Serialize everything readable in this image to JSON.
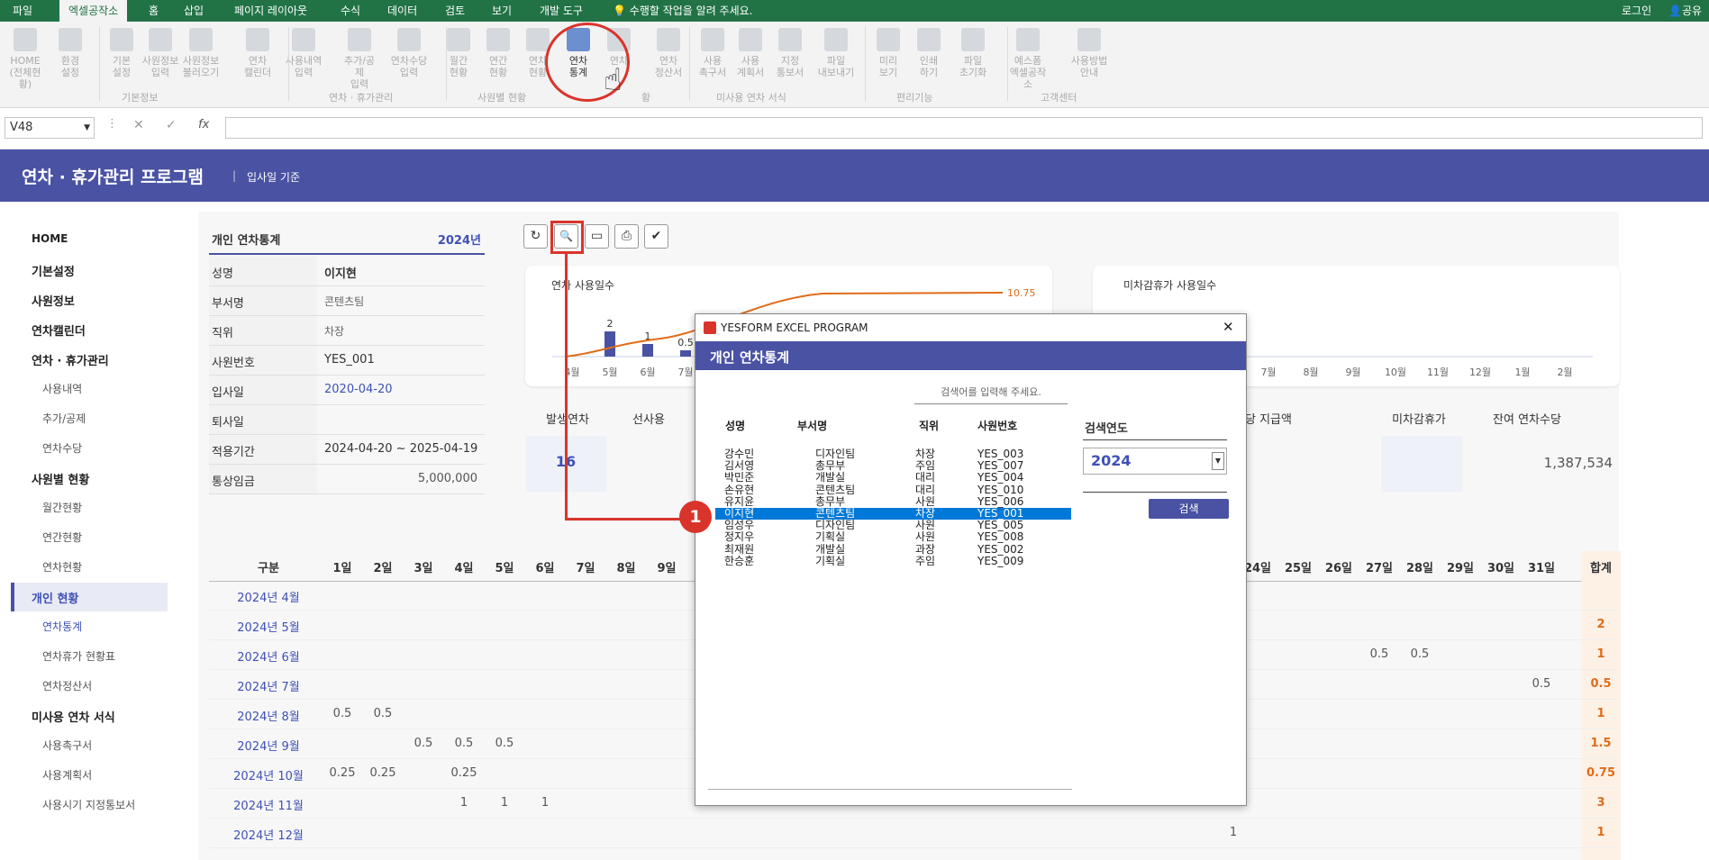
{
  "excel": {
    "menu": [
      "파일",
      "엑셀공작소",
      "홈",
      "삽입",
      "페이지 레이아웃",
      "수식",
      "데이터",
      "검토",
      "보기",
      "개발 도구"
    ],
    "tell_me": "수행할 작업을 알려 주세요.",
    "login": "로그인",
    "share": "공유",
    "ribbon": [
      {
        "l1": "HOME",
        "l2": "(전체현황)"
      },
      {
        "l1": "환경",
        "l2": "설정"
      },
      {
        "l1": "기본",
        "l2": "설정"
      },
      {
        "l1": "사원정보",
        "l2": "입력"
      },
      {
        "l1": "사원정보",
        "l2": "불러오기"
      },
      {
        "l1": "연차",
        "l2": "캘린더"
      },
      {
        "l1": "사용내역",
        "l2": "입력"
      },
      {
        "l1": "추가/공제",
        "l2": "입력"
      },
      {
        "l1": "연차수당",
        "l2": "입력"
      },
      {
        "l1": "월간",
        "l2": "현황"
      },
      {
        "l1": "연간",
        "l2": "현황"
      },
      {
        "l1": "연차",
        "l2": "현황"
      },
      {
        "l1": "연차",
        "l2": "통계"
      },
      {
        "l1": "연차",
        "l2": ""
      },
      {
        "l1": "",
        "l2": ""
      },
      {
        "l1": "연차",
        "l2": "정산서"
      },
      {
        "l1": "사용",
        "l2": "촉구서"
      },
      {
        "l1": "사용",
        "l2": "계획서"
      },
      {
        "l1": "지정",
        "l2": "통보서"
      },
      {
        "l1": "파일",
        "l2": "내보내기"
      },
      {
        "l1": "미리",
        "l2": "보기"
      },
      {
        "l1": "인쇄",
        "l2": "하기"
      },
      {
        "l1": "파일",
        "l2": "초기화"
      },
      {
        "l1": "예스폼",
        "l2": "엑셀공작소"
      },
      {
        "l1": "사용방법",
        "l2": "안내"
      }
    ],
    "groups": [
      "기본정보",
      "연차 · 휴가관리",
      "사원별 현황",
      "미사용 연차 서식",
      "편리기능",
      "고객센터"
    ],
    "group_partial": "황",
    "namebox": "V48",
    "fx": "fx"
  },
  "app": {
    "title": "연차 · 휴가관리 프로그램",
    "subtitle": "입사일 기준"
  },
  "sidebar": [
    {
      "label": "HOME",
      "type": "main"
    },
    {
      "label": "기본설정",
      "type": "main"
    },
    {
      "label": "사원정보",
      "type": "main"
    },
    {
      "label": "연차캘린더",
      "type": "main"
    },
    {
      "label": "연차 · 휴가관리",
      "type": "main"
    },
    {
      "label": "사용내역",
      "type": "sub"
    },
    {
      "label": "추가/공제",
      "type": "sub"
    },
    {
      "label": "연차수당",
      "type": "sub"
    },
    {
      "label": "사원별 현황",
      "type": "main"
    },
    {
      "label": "월간현황",
      "type": "sub"
    },
    {
      "label": "연간현황",
      "type": "sub"
    },
    {
      "label": "연차현황",
      "type": "sub"
    },
    {
      "label": "개인 현황",
      "type": "active"
    },
    {
      "label": "연차통계",
      "type": "cur"
    },
    {
      "label": "연차휴가 현황표",
      "type": "sub"
    },
    {
      "label": "연차정산서",
      "type": "sub"
    },
    {
      "label": "미사용 연차 서식",
      "type": "main"
    },
    {
      "label": "사용촉구서",
      "type": "sub"
    },
    {
      "label": "사용계획서",
      "type": "sub"
    },
    {
      "label": "사용시기 지정통보서",
      "type": "sub"
    }
  ],
  "info": {
    "title": "개인 연차통계",
    "year": "2024년",
    "rows": [
      {
        "label": "성명",
        "value": "이지현"
      },
      {
        "label": "부서명",
        "value": "콘텐츠팀"
      },
      {
        "label": "직위",
        "value": "차장"
      },
      {
        "label": "사원번호",
        "value": "YES_001"
      },
      {
        "label": "입사일",
        "value": "2020-04-20"
      },
      {
        "label": "퇴사일",
        "value": ""
      },
      {
        "label": "적용기간",
        "value": "2024-04-20 ~ 2025-04-19"
      },
      {
        "label": "통상임금",
        "value": "5,000,000"
      }
    ]
  },
  "toolbar": {
    "refresh": "↻",
    "search": "🔍",
    "screen": "▭",
    "print": "⎙",
    "check": "✔"
  },
  "chart1": {
    "title": "연차 사용일수",
    "chart_data": {
      "type": "bar",
      "categories": [
        "4월",
        "5월",
        "6월",
        "7월"
      ],
      "values": [
        0,
        2,
        1,
        0.5
      ],
      "line_end_label": "10.75"
    }
  },
  "chart2": {
    "title": "미차감휴가 사용일수",
    "chart_data": {
      "type": "bar",
      "categories": [
        "7월",
        "8월",
        "9월",
        "10월",
        "11월",
        "12월",
        "1월",
        "2월"
      ],
      "values": [
        0,
        0,
        0,
        0,
        0,
        0,
        0,
        0
      ]
    }
  },
  "summary": {
    "headers": [
      "발생연차",
      "선사용",
      "당 지급액",
      "미차감휴가",
      "잔여 연차수당"
    ],
    "issued": "16",
    "remaining_pay": "1,387,534"
  },
  "table": {
    "col_header": "구분",
    "days_left": [
      "1일",
      "2일",
      "3일",
      "4일",
      "5일",
      "6일",
      "7일",
      "8일",
      "9일"
    ],
    "days_right": [
      "24일",
      "25일",
      "26일",
      "27일",
      "28일",
      "29일",
      "30일",
      "31일"
    ],
    "total_header": "합계",
    "rows": [
      {
        "label": "2024년 4월",
        "total": ""
      },
      {
        "label": "2024년 5월",
        "total": "2"
      },
      {
        "label": "2024년 6월",
        "total": "1"
      },
      {
        "label": "2024년 7월",
        "total": "0.5"
      },
      {
        "label": "2024년 8월",
        "total": "1"
      },
      {
        "label": "2024년 9월",
        "total": "1.5"
      },
      {
        "label": "2024년 10월",
        "total": "0.75"
      },
      {
        "label": "2024년 11월",
        "total": "3"
      },
      {
        "label": "2024년 12월",
        "total": "1"
      }
    ],
    "cells": [
      {
        "row": 2,
        "col": "27",
        "v": "0.5"
      },
      {
        "row": 2,
        "col": "28",
        "v": "0.5"
      },
      {
        "row": 3,
        "col": "31",
        "v": "0.5"
      },
      {
        "row": 4,
        "col": "1",
        "v": "0.5"
      },
      {
        "row": 4,
        "col": "2",
        "v": "0.5"
      },
      {
        "row": 5,
        "col": "3",
        "v": "0.5"
      },
      {
        "row": 5,
        "col": "4",
        "v": "0.5"
      },
      {
        "row": 5,
        "col": "5",
        "v": "0.5"
      },
      {
        "row": 6,
        "col": "1",
        "v": "0.25"
      },
      {
        "row": 6,
        "col": "2",
        "v": "0.25"
      },
      {
        "row": 6,
        "col": "4",
        "v": "0.25"
      },
      {
        "row": 7,
        "col": "4",
        "v": "1"
      },
      {
        "row": 7,
        "col": "5",
        "v": "1"
      },
      {
        "row": 7,
        "col": "6",
        "v": "1"
      },
      {
        "row": 8,
        "col": "23",
        "v": "1"
      }
    ]
  },
  "dialog": {
    "window_title": "YESFORM EXCEL PROGRAM",
    "header": "개인 연차통계",
    "search_placeholder": "검색어를 입력해 주세요.",
    "cols": [
      "성명",
      "부서명",
      "직위",
      "사원번호"
    ],
    "rows": [
      {
        "name": "강수민",
        "dept": "디자인팀",
        "pos": "차장",
        "id": "YES_003"
      },
      {
        "name": "김서영",
        "dept": "총무부",
        "pos": "주임",
        "id": "YES_007"
      },
      {
        "name": "박민준",
        "dept": "개발실",
        "pos": "대리",
        "id": "YES_004"
      },
      {
        "name": "손유현",
        "dept": "콘텐츠팀",
        "pos": "대리",
        "id": "YES_010"
      },
      {
        "name": "유지윤",
        "dept": "총무부",
        "pos": "사원",
        "id": "YES_006"
      },
      {
        "name": "이지현",
        "dept": "콘텐츠팀",
        "pos": "차장",
        "id": "YES_001",
        "selected": true
      },
      {
        "name": "임성우",
        "dept": "디자인팀",
        "pos": "사원",
        "id": "YES_005"
      },
      {
        "name": "정지우",
        "dept": "기획실",
        "pos": "사원",
        "id": "YES_008"
      },
      {
        "name": "최재원",
        "dept": "개발실",
        "pos": "과장",
        "id": "YES_002"
      },
      {
        "name": "한승훈",
        "dept": "기획실",
        "pos": "주임",
        "id": "YES_009"
      }
    ],
    "year_label": "검색연도",
    "year_value": "2024",
    "search_button": "검색",
    "close": "✕"
  },
  "callout": {
    "number": "1"
  },
  "colors": {
    "excel_green": "#217346",
    "header_blue": "#4a52a3",
    "orange": "#e06c1a",
    "callout_red": "#d9342b",
    "select_blue": "#0078d7"
  }
}
